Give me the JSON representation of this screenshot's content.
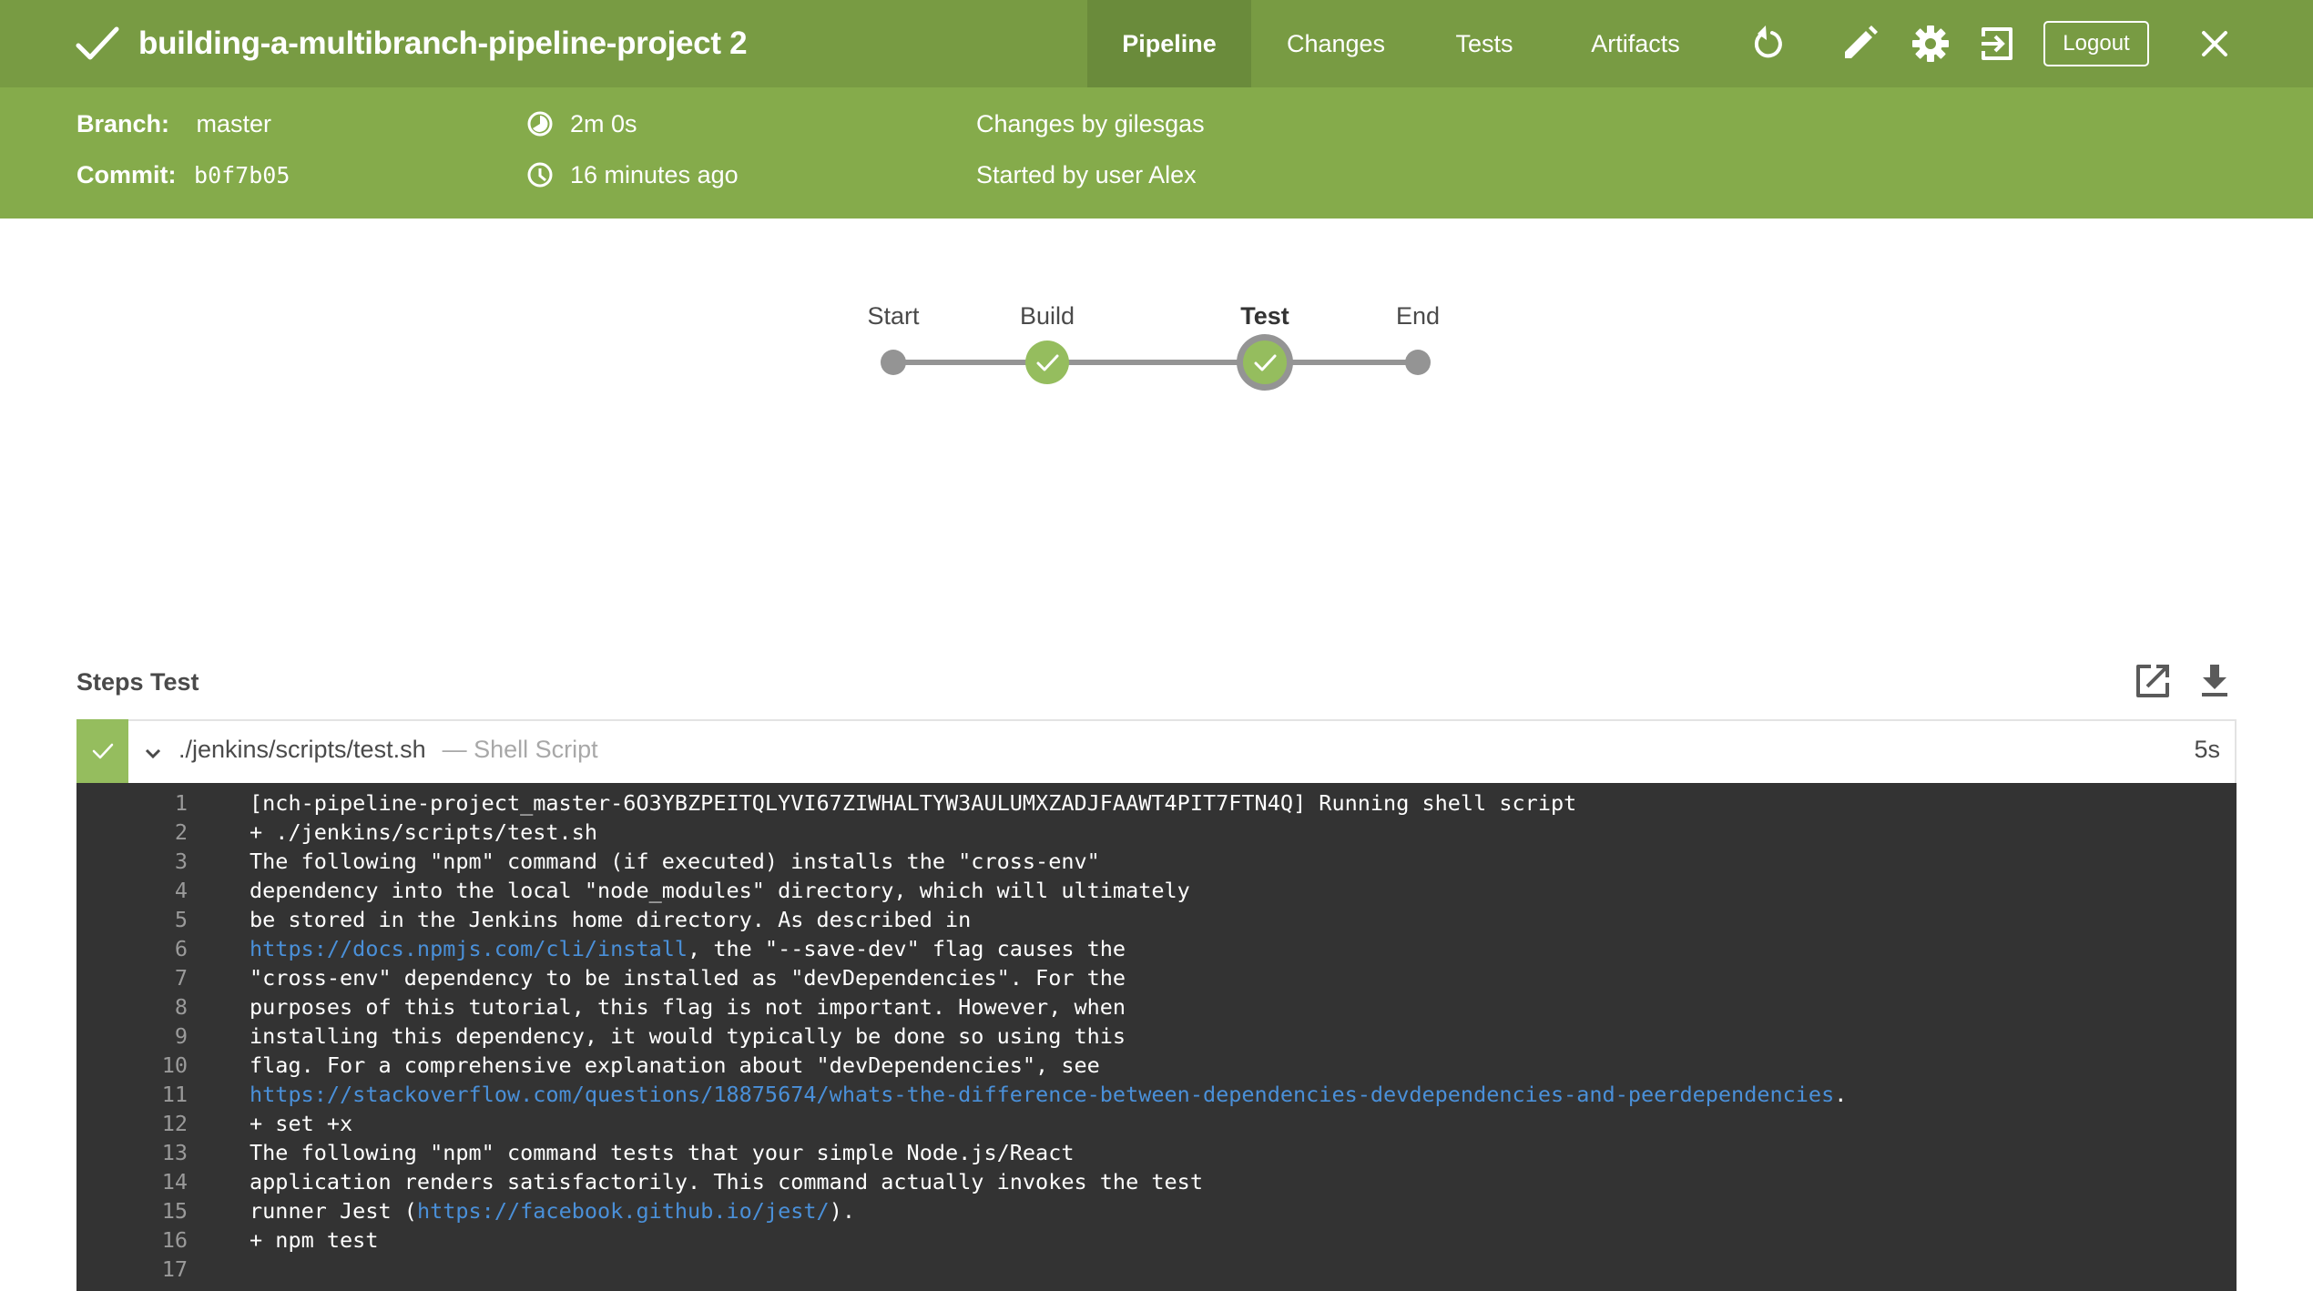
{
  "header": {
    "status_icon": "check-icon",
    "title": "building-a-multibranch-pipeline-project 2",
    "tabs": [
      {
        "label": "Pipeline",
        "active": true
      },
      {
        "label": "Changes",
        "active": false
      },
      {
        "label": "Tests",
        "active": false
      },
      {
        "label": "Artifacts",
        "active": false
      }
    ],
    "actions": [
      "rerun-icon",
      "edit-icon",
      "settings-icon",
      "go-to-classic-icon"
    ],
    "logout_label": "Logout",
    "close_icon": "close-icon"
  },
  "summary": {
    "branch_label": "Branch:",
    "branch_value": "master",
    "commit_label": "Commit:",
    "commit_value": "b0f7b05",
    "duration": "2m 0s",
    "started_ago": "16 minutes ago",
    "changes_by": "Changes by gilesgas",
    "started_by": "Started by user Alex"
  },
  "pipeline": {
    "stages": [
      {
        "label": "Start",
        "status": "none",
        "selected": false
      },
      {
        "label": "Build",
        "status": "success",
        "selected": false
      },
      {
        "label": "Test",
        "status": "success",
        "selected": true
      },
      {
        "label": "End",
        "status": "none",
        "selected": false
      }
    ],
    "colors": {
      "success": "#95bd5e",
      "track": "#949494"
    }
  },
  "steps": {
    "title": "Steps Test",
    "actions": [
      "open-in-new-icon",
      "download-icon"
    ],
    "items": [
      {
        "status": "success",
        "name": "./jenkins/scripts/test.sh",
        "type": "— Shell Script",
        "duration": "5s",
        "expanded": true
      }
    ]
  },
  "log": {
    "lines": [
      {
        "n": "1",
        "segments": [
          {
            "text": "[nch-pipeline-project_master-6O3YBZPEITQLYVI67ZIWHALTYW3AULUMXZADJFAAWT4PIT7FTN4Q] Running shell script"
          }
        ]
      },
      {
        "n": "2",
        "segments": [
          {
            "text": "+ ./jenkins/scripts/test.sh"
          }
        ]
      },
      {
        "n": "3",
        "segments": [
          {
            "text": "The following \"npm\" command (if executed) installs the \"cross-env\""
          }
        ]
      },
      {
        "n": "4",
        "segments": [
          {
            "text": "dependency into the local \"node_modules\" directory, which will ultimately"
          }
        ]
      },
      {
        "n": "5",
        "segments": [
          {
            "text": "be stored in the Jenkins home directory. As described in"
          }
        ]
      },
      {
        "n": "6",
        "segments": [
          {
            "text": "https://docs.npmjs.com/cli/install",
            "link": true
          },
          {
            "text": ", the \"--save-dev\" flag causes the"
          }
        ]
      },
      {
        "n": "7",
        "segments": [
          {
            "text": "\"cross-env\" dependency to be installed as \"devDependencies\". For the"
          }
        ]
      },
      {
        "n": "8",
        "segments": [
          {
            "text": "purposes of this tutorial, this flag is not important. However, when"
          }
        ]
      },
      {
        "n": "9",
        "segments": [
          {
            "text": "installing this dependency, it would typically be done so using this"
          }
        ]
      },
      {
        "n": "10",
        "segments": [
          {
            "text": "flag. For a comprehensive explanation about \"devDependencies\", see"
          }
        ]
      },
      {
        "n": "11",
        "segments": [
          {
            "text": "https://stackoverflow.com/questions/18875674/whats-the-difference-between-dependencies-devdependencies-and-peerdependencies",
            "link": true
          },
          {
            "text": "."
          }
        ]
      },
      {
        "n": "12",
        "segments": [
          {
            "text": "+ set +x"
          }
        ]
      },
      {
        "n": "13",
        "segments": [
          {
            "text": "The following \"npm\" command tests that your simple Node.js/React"
          }
        ]
      },
      {
        "n": "14",
        "segments": [
          {
            "text": "application renders satisfactorily. This command actually invokes the test"
          }
        ]
      },
      {
        "n": "15",
        "segments": [
          {
            "text": "runner Jest ("
          },
          {
            "text": "https://facebook.github.io/jest/",
            "link": true
          },
          {
            "text": ")."
          }
        ]
      },
      {
        "n": "16",
        "segments": [
          {
            "text": "+ npm test"
          }
        ]
      },
      {
        "n": "17",
        "segments": [
          {
            "text": ""
          }
        ]
      }
    ]
  }
}
